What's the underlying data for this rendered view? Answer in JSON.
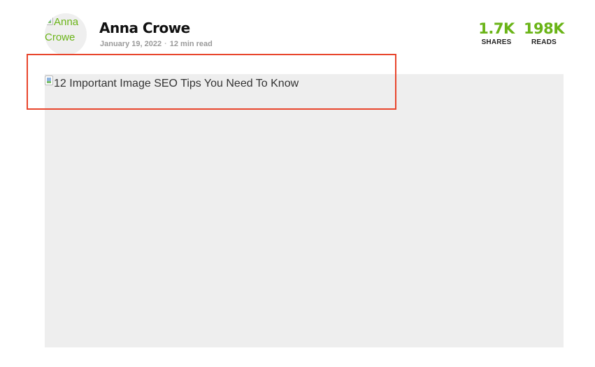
{
  "author": {
    "avatar_alt": "Anna Crowe",
    "name": "Anna Crowe",
    "date": "January 19, 2022",
    "separator": "·",
    "read_time": "12 min read"
  },
  "stats": {
    "shares_value": "1.7K",
    "shares_label": "SHARES",
    "reads_value": "198K",
    "reads_label": "READS"
  },
  "featured_image": {
    "alt": "12 Important Image SEO Tips You Need To Know"
  },
  "colors": {
    "accent_green": "#6ab417",
    "highlight_red": "#e8452c",
    "placeholder_gray": "#eeeeee"
  }
}
